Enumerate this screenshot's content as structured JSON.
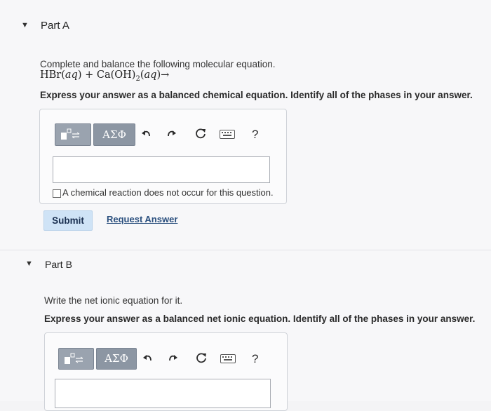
{
  "part_a": {
    "title": "Part A",
    "prompt": "Complete and balance the following molecular equation.",
    "equation": {
      "r1": "HBr(",
      "r1_phase": "aq",
      "plus": ") + Ca(OH)",
      "sub": "2",
      "r2_open": "(",
      "r2_phase": "aq",
      "arrow": ")→"
    },
    "instruction": "Express your answer as a balanced chemical equation. Identify all of the phases in your answer.",
    "toolbar": {
      "greek_label": "ΑΣΦ",
      "help_label": "?"
    },
    "checkbox_label": "A chemical reaction does not occur for this question.",
    "submit_label": "Submit",
    "request_label": "Request Answer"
  },
  "part_b": {
    "title": "Part B",
    "prompt": "Write the net ionic equation for it.",
    "instruction": "Express your answer as a balanced net ionic equation. Identify all of the phases in your answer.",
    "toolbar": {
      "greek_label": "ΑΣΦ",
      "help_label": "?"
    }
  }
}
